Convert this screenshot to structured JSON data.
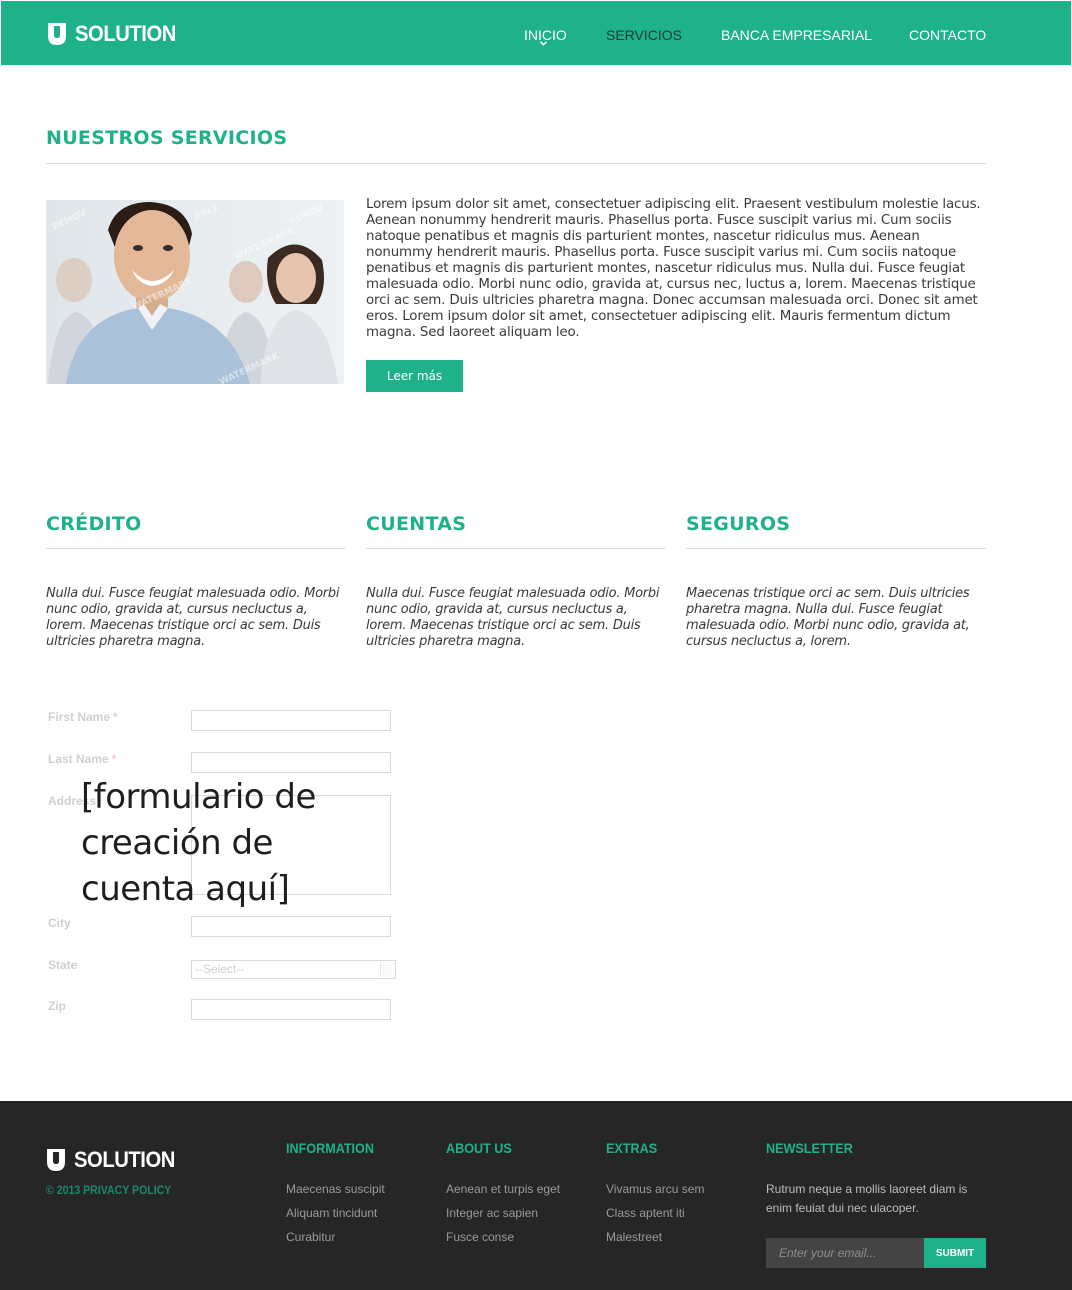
{
  "brand": {
    "name": "SOLUTION",
    "accent": "#1fb28a",
    "icon": "u-logo-icon"
  },
  "nav": {
    "items": [
      {
        "label": "INICIO",
        "active": true
      },
      {
        "label": "SERVICIOS"
      },
      {
        "label": "BANCA EMPRESARIAL"
      },
      {
        "label": "CONTACTO"
      }
    ]
  },
  "services": {
    "title": "NUESTROS SERVICIOS",
    "body": "Lorem ipsum dolor sit amet, consectetuer adipiscing elit. Praesent vestibulum molestie lacus. Aenean nonummy hendrerit mauris. Phasellus porta. Fusce suscipit varius mi. Cum sociis natoque penatibus et magnis dis parturient montes, nascetur ridiculus mus. Aenean nonummy hendrerit mauris. Phasellus porta. Fusce suscipit varius mi. Cum sociis natoque penatibus et magnis dis parturient montes, nascetur ridiculus mus. Nulla dui. Fusce feugiat malesuada odio. Morbi nunc odio, gravida at, cursus nec, luctus a, lorem. Maecenas tristique orci ac sem. Duis ultricies pharetra magna. Donec accumsan malesuada orci. Donec sit amet eros. Lorem ipsum dolor sit amet, consectetuer adipiscing elit. Mauris fermentum dictum magna. Sed laoreet aliquam leo.",
    "button": "Leer más",
    "photo_watermark": "REMOVABLE WATERMARK"
  },
  "columns": [
    {
      "title": "CRÉDITO",
      "text": "Nulla dui. Fusce feugiat malesuada odio. Morbi nunc odio, gravida at, cursus necluctus a, lorem. Maecenas tristique orci ac sem. Duis ultricies pharetra magna."
    },
    {
      "title": "CUENTAS",
      "text": "Nulla dui. Fusce feugiat malesuada odio. Morbi nunc odio, gravida at, cursus necluctus a, lorem. Maecenas tristique orci ac sem. Duis ultricies pharetra magna."
    },
    {
      "title": "SEGUROS",
      "text": "Maecenas tristique orci ac sem. Duis ultricies pharetra magna. Nulla dui. Fusce feugiat malesuada odio. Morbi nunc odio, gravida at, cursus necluctus a, lorem."
    }
  ],
  "form": {
    "first_name": "First Name",
    "last_name": "Last Name",
    "address": "Address",
    "city": "City",
    "state": "State",
    "state_value": "--Select--",
    "zip": "Zip",
    "required_mark": "*",
    "overlay_note": "[formulario de creación de cuenta aquí]"
  },
  "footer": {
    "brand": "SOLUTION",
    "copyright": "© 2013 PRIVACY POLICY",
    "information": {
      "title": "INFORMATION",
      "links": [
        "Maecenas suscipit",
        "Aliquam tincidunt",
        "Curabitur"
      ]
    },
    "about": {
      "title": "ABOUT US",
      "links": [
        "Aenean et turpis eget",
        "Integer ac sapien",
        "Fusce conse"
      ]
    },
    "extras": {
      "title": "EXTRAS",
      "links": [
        "Vivamus arcu sem",
        "Class aptent iti",
        "Malestreet"
      ]
    },
    "newsletter": {
      "title": "NEWSLETTER",
      "text": "Rutrum neque a mollis laoreet diam is enim feuiat dui nec ulacoper.",
      "placeholder": "Enter your email...",
      "submit": "SUBMIT"
    }
  }
}
